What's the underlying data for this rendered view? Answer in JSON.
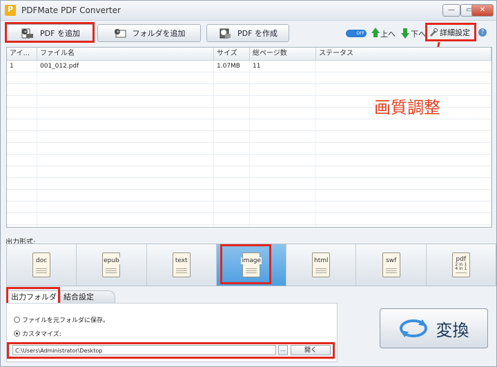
{
  "window": {
    "title": "PDFMate PDF Converter",
    "minimize_label": "—",
    "maximize_label": "▭",
    "close_label": "✕"
  },
  "toolbar": {
    "add_pdf_label": "PDF を追加",
    "add_folder_label": "フォルダを追加",
    "create_pdf_label": "PDF を作成",
    "toggle_label": "OFF",
    "move_up_label": "上へ",
    "move_down_label": "下へ",
    "advanced_label": "詳細設定",
    "help_label": "?"
  },
  "table": {
    "columns": [
      "アイ...",
      "ファイル名",
      "サイズ",
      "総ページ数",
      "ステータス"
    ],
    "rows": [
      {
        "index": "1",
        "filename": "001_012.pdf",
        "size": "1.07MB",
        "pages": "11",
        "status": ""
      }
    ]
  },
  "annotation": {
    "text": "画質調整",
    "color": "#e0401f"
  },
  "output_format": {
    "label": "出力形式:",
    "formats": [
      "doc",
      "epub",
      "text",
      "image",
      "html",
      "swf",
      "pdf"
    ],
    "pdf_sub": "2 in 1\n4 in 1",
    "selected": "image"
  },
  "tabs": {
    "output_folder": "出力フォルダ",
    "merge_settings": "結合設定"
  },
  "output": {
    "option_source_folder": "ファイルを元フォルダに保存。",
    "option_custom": "カスタマイズ:",
    "path_value": "C:\\Users\\Administrator\\Desktop",
    "browse_label": "...",
    "open_label": "開く"
  },
  "convert_label": "変換",
  "colors": {
    "highlight": "#e0271d",
    "selected_format": "#4c9ee0",
    "arrow_green": "#2aa33a"
  }
}
